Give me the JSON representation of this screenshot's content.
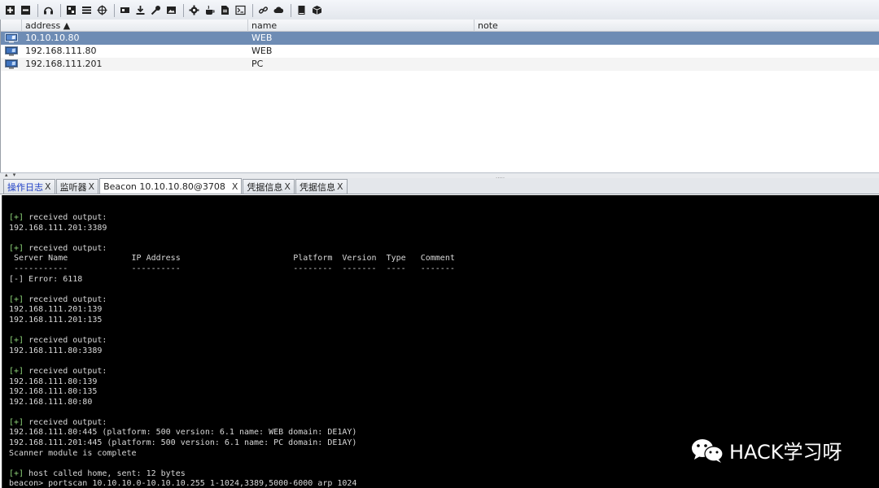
{
  "toolbar": {
    "buttons": [
      {
        "icon": "connect-icon"
      },
      {
        "icon": "disconnect-icon"
      },
      {
        "icon": "headset-icon"
      },
      {
        "icon": "pivot-graph-icon"
      },
      {
        "icon": "session-table-icon"
      },
      {
        "icon": "target-table-icon"
      },
      {
        "icon": "credentials-icon"
      },
      {
        "icon": "downloads-icon"
      },
      {
        "icon": "keystrokes-icon"
      },
      {
        "icon": "screenshots-icon"
      },
      {
        "icon": "payload-generator-icon"
      },
      {
        "icon": "java-icon"
      },
      {
        "icon": "office-document-icon"
      },
      {
        "icon": "script-console-icon"
      },
      {
        "icon": "link-icon"
      },
      {
        "icon": "cloud-icon"
      },
      {
        "icon": "book-icon"
      },
      {
        "icon": "cube-icon"
      }
    ]
  },
  "targets": {
    "columns": {
      "address": "address ▲",
      "name": "name",
      "note": "note"
    },
    "rows": [
      {
        "address": "10.10.10.80",
        "name": "WEB",
        "note": "",
        "selected": true
      },
      {
        "address": "192.168.111.80",
        "name": "WEB",
        "note": "",
        "selected": false
      },
      {
        "address": "192.168.111.201",
        "name": "PC",
        "note": "",
        "selected": false
      }
    ]
  },
  "splitter": {
    "arrows": "▴ ▾",
    "grip": "....."
  },
  "tabs": [
    {
      "label": "操作日志",
      "close": "X",
      "active": false,
      "kind": "log"
    },
    {
      "label": "监听器",
      "close": "X",
      "active": false,
      "kind": "listeners"
    },
    {
      "label": "Beacon 10.10.10.80@3708",
      "close": "X",
      "active": true,
      "kind": "beacon"
    },
    {
      "label": "凭据信息",
      "close": "X",
      "active": false,
      "kind": "credentials"
    },
    {
      "label": "凭据信息",
      "close": "X",
      "active": false,
      "kind": "credentials"
    }
  ],
  "console": {
    "lines": [
      {
        "tag": "[+]",
        "text": " received output:"
      },
      {
        "tag": "",
        "text": "192.168.111.201:3389"
      },
      {
        "tag": "",
        "text": ""
      },
      {
        "tag": "[+]",
        "text": " received output:"
      },
      {
        "tag": "",
        "text": " Server Name             IP Address                       Platform  Version  Type   Comment"
      },
      {
        "tag": "",
        "text": " -----------             ----------                       --------  -------  ----   -------"
      },
      {
        "tag": "",
        "text": "[-] Error: 6118"
      },
      {
        "tag": "",
        "text": ""
      },
      {
        "tag": "[+]",
        "text": " received output:"
      },
      {
        "tag": "",
        "text": "192.168.111.201:139"
      },
      {
        "tag": "",
        "text": "192.168.111.201:135"
      },
      {
        "tag": "",
        "text": ""
      },
      {
        "tag": "[+]",
        "text": " received output:"
      },
      {
        "tag": "",
        "text": "192.168.111.80:3389"
      },
      {
        "tag": "",
        "text": ""
      },
      {
        "tag": "[+]",
        "text": " received output:"
      },
      {
        "tag": "",
        "text": "192.168.111.80:139"
      },
      {
        "tag": "",
        "text": "192.168.111.80:135"
      },
      {
        "tag": "",
        "text": "192.168.111.80:80"
      },
      {
        "tag": "",
        "text": ""
      },
      {
        "tag": "[+]",
        "text": " received output:"
      },
      {
        "tag": "",
        "text": "192.168.111.80:445 (platform: 500 version: 6.1 name: WEB domain: DE1AY)"
      },
      {
        "tag": "",
        "text": "192.168.111.201:445 (platform: 500 version: 6.1 name: PC domain: DE1AY)"
      },
      {
        "tag": "",
        "text": "Scanner module is complete"
      },
      {
        "tag": "",
        "text": ""
      },
      {
        "tag": "[+]",
        "text": " host called home, sent: 12 bytes"
      },
      {
        "tag": "",
        "text": "beacon> portscan 10.10.10.0-10.10.10.255 1-1024,3389,5000-6000 arp 1024"
      }
    ]
  },
  "watermark": {
    "text": "HACK学习呀",
    "logo": "wechat-logo-icon"
  },
  "colors": {
    "selected_row": "#6e8cb4",
    "console_bg": "#000000",
    "console_text": "#d8d8d8",
    "console_ok": "#8fd57a",
    "log_tab_text": "#1f3fc6"
  }
}
